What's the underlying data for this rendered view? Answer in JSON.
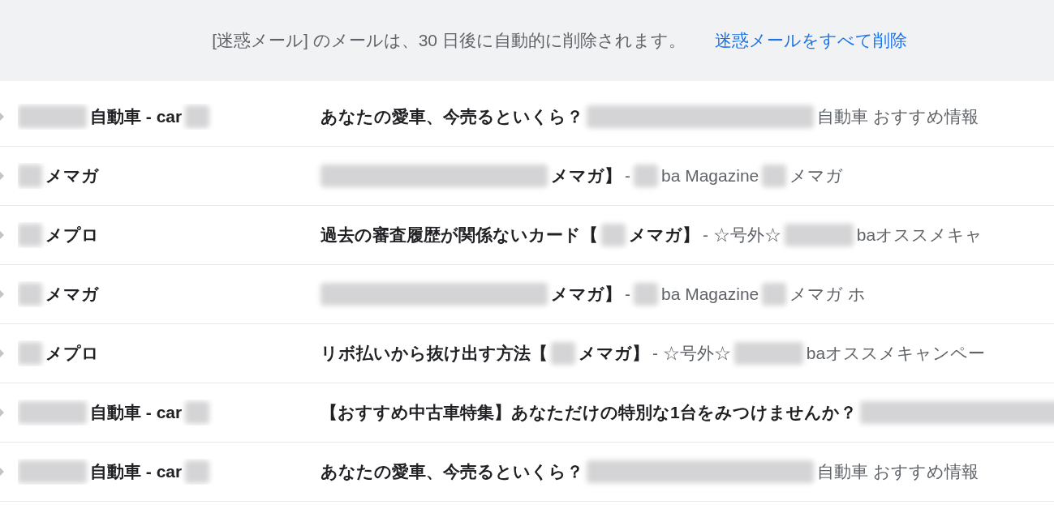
{
  "banner": {
    "message": "[迷惑メール] のメールは、30 日後に自動的に削除されます。",
    "action": "迷惑メールをすべて削除"
  },
  "rows": [
    {
      "unread": true,
      "sender": [
        {
          "kind": "blur"
        },
        {
          "kind": "text",
          "text": "自動車 - car"
        },
        {
          "kind": "smudge"
        }
      ],
      "subject": [
        {
          "kind": "text",
          "text": "あなたの愛車、今売るといくら？"
        },
        {
          "kind": "band"
        }
      ],
      "snippet": [
        {
          "kind": "text",
          "text": "自動車 おすすめ情報"
        }
      ]
    },
    {
      "unread": true,
      "sender": [
        {
          "kind": "smudge"
        },
        {
          "kind": "text",
          "text": "メマガ"
        }
      ],
      "subject": [
        {
          "kind": "band"
        },
        {
          "kind": "text",
          "text": "メマガ】"
        }
      ],
      "snippet": [
        {
          "kind": "text",
          "text": "-"
        },
        {
          "kind": "smudge"
        },
        {
          "kind": "text",
          "text": "ba Magazine"
        },
        {
          "kind": "smudge"
        },
        {
          "kind": "text",
          "text": "メマガ"
        }
      ]
    },
    {
      "unread": true,
      "sender": [
        {
          "kind": "smudge"
        },
        {
          "kind": "text",
          "text": "メプロ"
        }
      ],
      "subject": [
        {
          "kind": "text",
          "text": "過去の審査履歴が関係ないカード【"
        },
        {
          "kind": "smudge"
        },
        {
          "kind": "text",
          "text": "メマガ】"
        }
      ],
      "snippet": [
        {
          "kind": "text",
          "text": "- ☆号外☆"
        },
        {
          "kind": "blur"
        },
        {
          "kind": "text",
          "text": "baオススメキャ"
        }
      ]
    },
    {
      "unread": true,
      "sender": [
        {
          "kind": "smudge"
        },
        {
          "kind": "text",
          "text": "メマガ"
        }
      ],
      "subject": [
        {
          "kind": "band"
        },
        {
          "kind": "text",
          "text": "メマガ】"
        }
      ],
      "snippet": [
        {
          "kind": "text",
          "text": "-"
        },
        {
          "kind": "smudge"
        },
        {
          "kind": "text",
          "text": "ba Magazine"
        },
        {
          "kind": "smudge"
        },
        {
          "kind": "text",
          "text": "メマガ ホ"
        }
      ]
    },
    {
      "unread": true,
      "sender": [
        {
          "kind": "smudge"
        },
        {
          "kind": "text",
          "text": "メプロ"
        }
      ],
      "subject": [
        {
          "kind": "text",
          "text": "リボ払いから抜け出す方法【"
        },
        {
          "kind": "smudge"
        },
        {
          "kind": "text",
          "text": "メマガ】"
        }
      ],
      "snippet": [
        {
          "kind": "text",
          "text": "- ☆号外☆"
        },
        {
          "kind": "blur"
        },
        {
          "kind": "text",
          "text": "baオススメキャンペー"
        }
      ]
    },
    {
      "unread": true,
      "sender": [
        {
          "kind": "blur"
        },
        {
          "kind": "text",
          "text": "自動車 - car"
        },
        {
          "kind": "smudge"
        }
      ],
      "subject": [
        {
          "kind": "text",
          "text": "【おすすめ中古車特集】あなただけの特別な1台をみつけませんか？"
        },
        {
          "kind": "band"
        }
      ],
      "snippet": []
    },
    {
      "unread": true,
      "sender": [
        {
          "kind": "blur"
        },
        {
          "kind": "text",
          "text": "自動車 - car"
        },
        {
          "kind": "smudge"
        }
      ],
      "subject": [
        {
          "kind": "text",
          "text": "あなたの愛車、今売るといくら？"
        },
        {
          "kind": "band"
        }
      ],
      "snippet": [
        {
          "kind": "text",
          "text": "自動車 おすすめ情報"
        }
      ]
    }
  ]
}
